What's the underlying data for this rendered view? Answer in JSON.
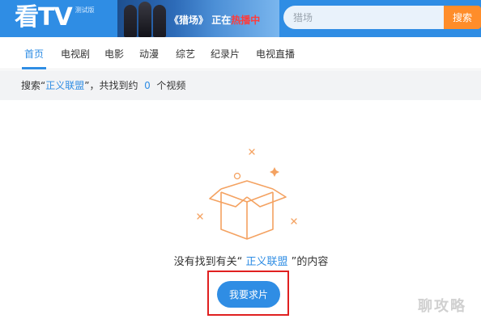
{
  "header": {
    "logo": "看TV",
    "logo_badge": "测试版",
    "banner": {
      "title": "《猎场》",
      "status_prefix": "正在",
      "status_hot": "热播中"
    },
    "search": {
      "placeholder": "猎场",
      "button_label": "搜索"
    }
  },
  "nav": {
    "items": [
      {
        "label": "首页",
        "active": true
      },
      {
        "label": "电视剧"
      },
      {
        "label": "电影"
      },
      {
        "label": "动漫"
      },
      {
        "label": "综艺"
      },
      {
        "label": "纪录片"
      },
      {
        "label": "电视直播"
      }
    ]
  },
  "result": {
    "prefix": "搜索“",
    "keyword": "正义联盟",
    "middle": "”，共找到约",
    "count": "0",
    "suffix": "个视频"
  },
  "empty": {
    "prefix": "没有找到有关“",
    "keyword": "正义联盟",
    "suffix": "”的内容",
    "button_label": "我要求片"
  },
  "watermark": "聊攻略",
  "colors": {
    "brand_blue": "#2f8de4",
    "search_orange": "#ff8d2a",
    "empty_orange": "#f4a261",
    "highlight_red": "#e02020"
  }
}
